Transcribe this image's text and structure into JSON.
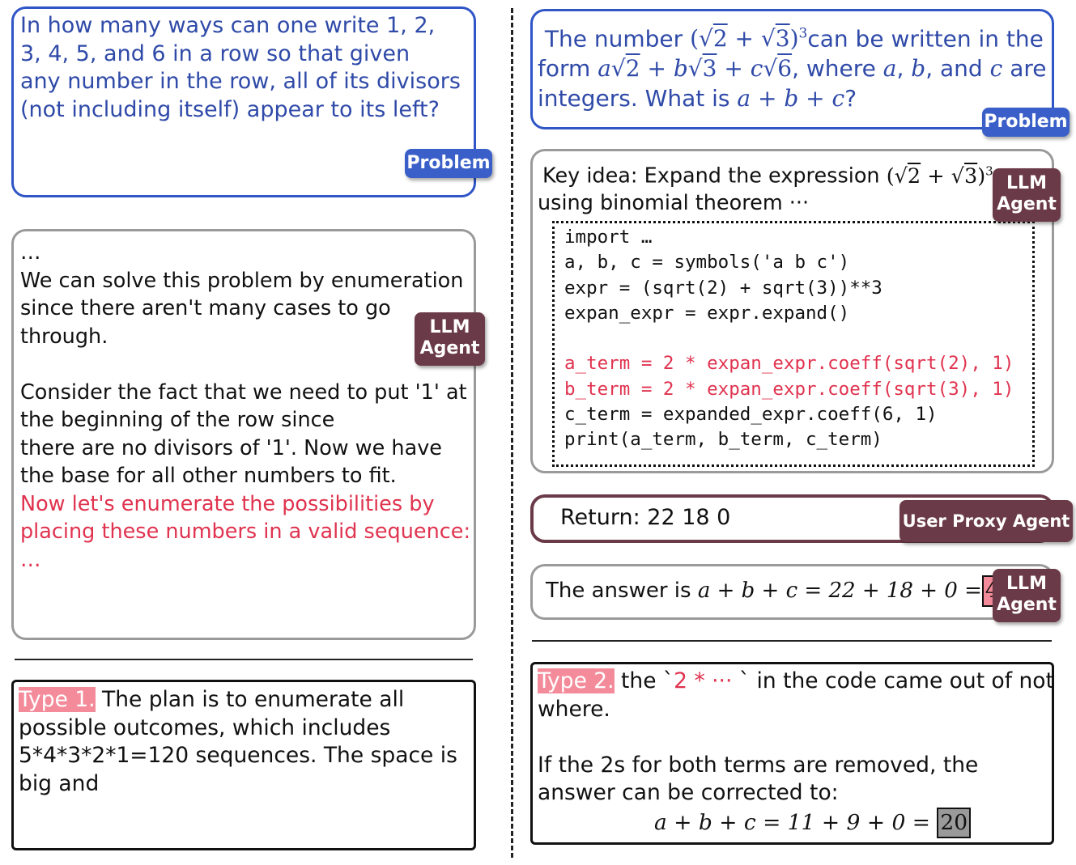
{
  "left": {
    "problem": {
      "lines": [
        "In how many ways can one write 1, 2,",
        "3, 4, 5, and 6 in a row so that given",
        "any number in the row, all of its divisors",
        "(not including itself) appear to its left?"
      ],
      "badge": "Problem"
    },
    "agent": {
      "badge_line1": "LLM",
      "badge_line2": "Agent",
      "ellipsis_top": "…",
      "lines": [
        "We can solve this problem by enumeration",
        "since there aren't many cases to go",
        "through."
      ],
      "lines2": [
        "Consider the fact that we need to put '1' at",
        "the beginning of the row since",
        "there are no divisors of '1'. Now we have",
        "the base for all other numbers to fit."
      ],
      "red_lines": [
        "Now let's enumerate the possibilities by",
        "placing these numbers in a valid sequence:",
        "…"
      ]
    },
    "note": {
      "tag": "Type 1.",
      "first": " The plan is to enumerate all",
      "lines": [
        "possible outcomes, which includes",
        "5*4*3*2*1=120 sequences. The space is",
        "big and"
      ]
    }
  },
  "right": {
    "problem": {
      "l1_pre": "The number ",
      "l1_post": "can be written in the",
      "l2_pre": "form ",
      "l2_mid": ", where ",
      "l2_and": ", and ",
      "l2_are": " are",
      "l3_pre": "integers.  What is ",
      "l3_post": "?",
      "badge": "Problem"
    },
    "agent": {
      "key_idea_pre": "Key idea: Expand the expression ",
      "key_idea_l2": "using binomial theorem ···",
      "badge_line1": "LLM",
      "badge_line2": "Agent",
      "code_lines": [
        "import …",
        "a, b, c = symbols('a b c')",
        "expr = (sqrt(2) + sqrt(3))**3",
        "expan_expr = expr.expand()"
      ],
      "code_red": [
        "a_term = 2 * expan_expr.coeff(sqrt(2), 1)",
        "b_term = 2 * expan_expr.coeff(sqrt(3), 1)"
      ],
      "code_tail": [
        "c_term = expanded_expr.coeff(6, 1)",
        "print(a_term, b_term, c_term)"
      ]
    },
    "proxy": {
      "text": "Return: 22 18 0",
      "badge": "User Proxy Agent"
    },
    "answer": {
      "pre": "The answer is ",
      "eq": "a + b + c = 22 + 18 + 0 =",
      "value": "40",
      "badge_line1": "LLM",
      "badge_line2": "Agent"
    },
    "note": {
      "tag": "Type 2.",
      "first": " the `",
      "red": "2 * ···",
      "first_post": " ` in the code came out of not",
      "l2": "where.",
      "l3": "If the 2s for both terms are removed, the",
      "l4": "answer can be corrected to:",
      "eq": "a + b + c = 11 + 9 + 0 =",
      "value": "20"
    }
  },
  "colors": {
    "problem_blue": "#2f55c6",
    "badge_blue": "#3a5fc8",
    "badge_plum": "#6b3a48",
    "highlight_red": "#e0334f",
    "tag_pink": "#f48b9a"
  }
}
